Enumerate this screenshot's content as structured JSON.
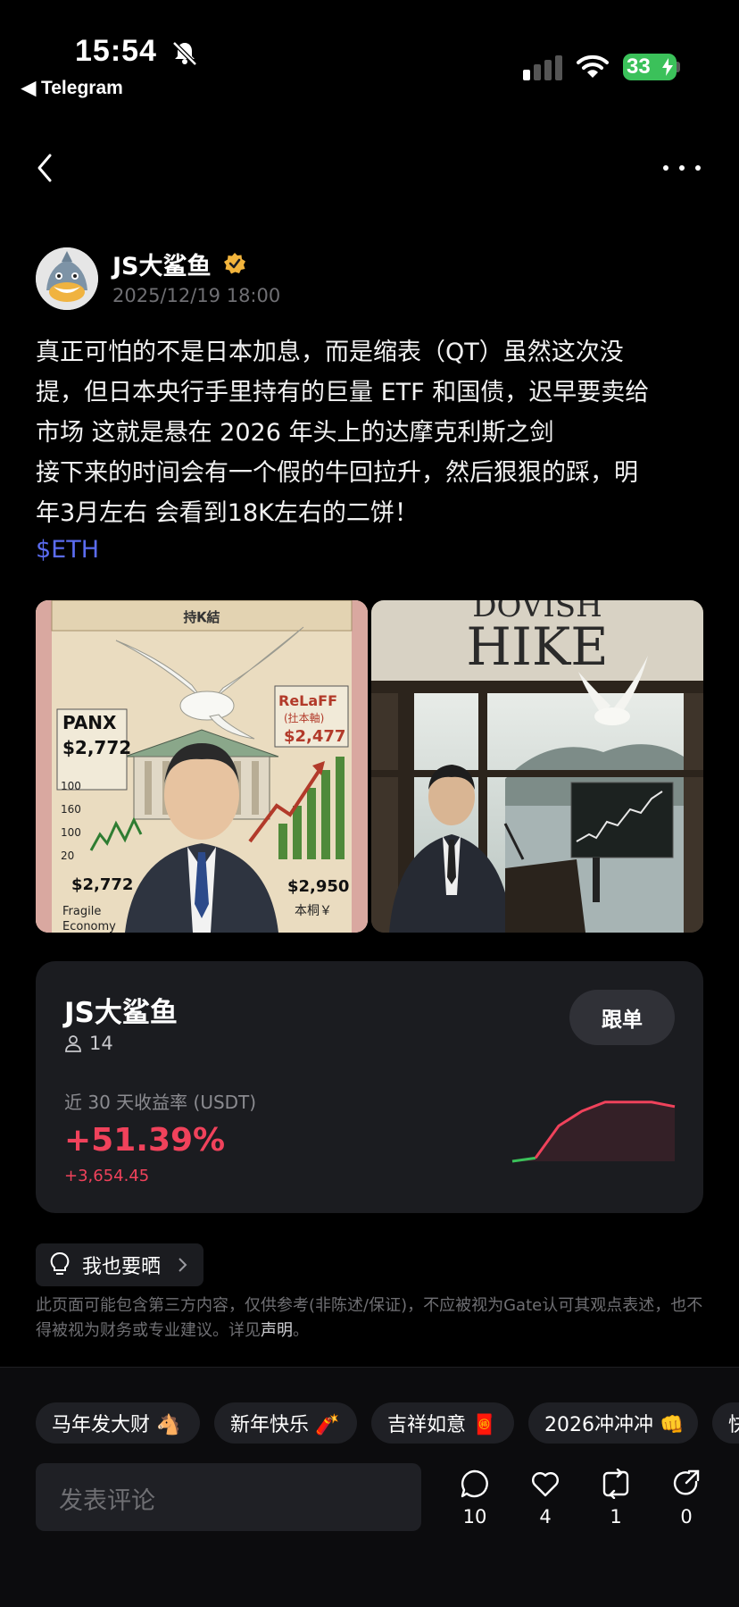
{
  "status_bar": {
    "time": "15:54",
    "back_app": "◀ Telegram",
    "battery": "33"
  },
  "post": {
    "author": "JS大鲨鱼",
    "timestamp": "2025/12/19 18:00",
    "body": "真正可怕的不是日本加息，而是缩表（QT）虽然这次没\n提，但日本央行手里持有的巨量 ETF 和国债，迟早要卖给\n市场 这就是悬在 2026 年头上的达摩克利斯之剑\n接下来的时间会有一个假的牛回拉升，然后狠狠的踩，明\n年3月左右 会看到18K左右的二饼！",
    "ticker": "$ETH"
  },
  "image_left": {
    "top_banner": "持𝐊結",
    "panx_label": "PANX",
    "panx_value": "$2,772",
    "ticks": [
      "100",
      "160",
      "100",
      "20"
    ],
    "bottom_left_value": "$2,772",
    "caption_line1": "Fragile",
    "caption_line2": "Economy",
    "relaff_label": "ReLaFF",
    "relaff_sub": "(扗本軸)",
    "relaff_value": "$2,477",
    "right_value": "$2,950",
    "right_caption": "本桐￥"
  },
  "image_right": {
    "headline": "HIKE",
    "headline_top": "DOVISH"
  },
  "trader": {
    "name": "JS大鲨鱼",
    "followers": "14",
    "follow_button": "跟单",
    "roi_label": "近 30 天收益率 (USDT)",
    "roi_percent": "+51.39%",
    "roi_amount": "+3,654.45",
    "sparkline": [
      0,
      0.05,
      0.55,
      0.78,
      0.92,
      0.92,
      0.92,
      0.85
    ],
    "up_color": "#f0425b",
    "start_color": "#3bc15a"
  },
  "share": {
    "label": "我也要晒"
  },
  "disclaimer": {
    "text": "此页面可能包含第三方内容，仅供参考(非陈述/保证)，不应被视为Gate认可其观点表述，也不得被视为财务或专业建议。详见",
    "link": "声明",
    "end": "。"
  },
  "chips": [
    "马年发大财 🐴",
    "新年快乐 🧨",
    "吉祥如意 🧧",
    "2026冲冲冲 👊",
    "快"
  ],
  "comment": {
    "placeholder": "发表评论"
  },
  "actions": [
    {
      "icon": "comment-icon",
      "count": "10"
    },
    {
      "icon": "heart-icon",
      "count": "4"
    },
    {
      "icon": "repost-icon",
      "count": "1"
    },
    {
      "icon": "share-icon",
      "count": "0"
    }
  ]
}
